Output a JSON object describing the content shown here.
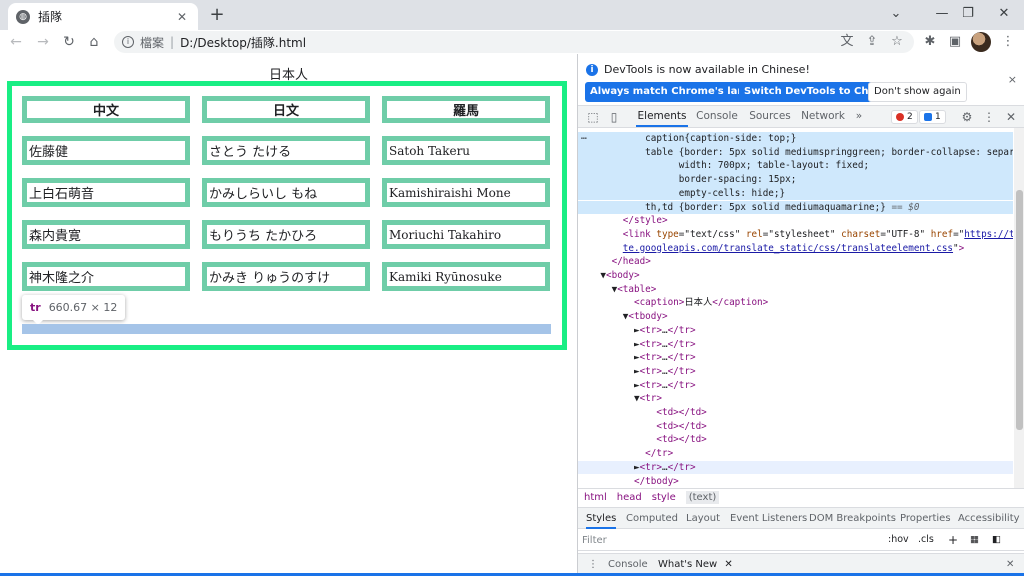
{
  "browser": {
    "tab_title": "插隊",
    "tab_close": "✕",
    "new_tab": "+",
    "window_controls": [
      "⌄",
      "—",
      "❐",
      "✕"
    ]
  },
  "toolbar": {
    "back": "←",
    "forward": "→",
    "reload": "↻",
    "home": "⌂",
    "info_glyph": "i",
    "scheme_label": "檔案",
    "separator": "|",
    "url": "D:/Desktop/插隊.html",
    "right_icons": [
      "文",
      "⇪",
      "☆"
    ],
    "extension_icons": [
      "✱",
      "▣",
      "⋮"
    ]
  },
  "page": {
    "caption": "日本人",
    "headers": [
      "中文",
      "日文",
      "羅馬"
    ],
    "rows": [
      [
        "佐藤健",
        "さとう たける",
        "Satoh Takeru"
      ],
      [
        "上白石萌音",
        "かみしらいし もね",
        "Kamishiraishi Mone"
      ],
      [
        "森内貴寛",
        "もりうち たかひろ",
        "Moriuchi Takahiro"
      ],
      [
        "神木隆之介",
        "かみき りゅうのすけ",
        "Kamiki Ryūnosuke"
      ]
    ],
    "tooltip_tag": "tr",
    "tooltip_dims": "660.67 × 12"
  },
  "devtools": {
    "info_icon": "i",
    "info_text": "DevTools is now available in Chinese!",
    "info_close": "×",
    "btn_match_language": "Always match Chrome's language",
    "btn_switch_chinese": "Switch DevTools to Chinese",
    "btn_dont_show": "Don't show again",
    "inspect_icon": "⬚",
    "device_icon": "▯",
    "tabs": [
      "Elements",
      "Console",
      "Sources",
      "Network"
    ],
    "more_tabs": "»",
    "error_count": "2",
    "message_count": "1",
    "settings_icon": "⚙",
    "menu_icon": "⋮",
    "close_icon": "✕",
    "breadcrumbs": [
      "html",
      "head",
      "style",
      "(text)"
    ],
    "sub_tabs": [
      "Styles",
      "Computed",
      "Layout",
      "Event Listeners",
      "DOM Breakpoints",
      "Properties",
      "Accessibility"
    ],
    "filter_placeholder": "Filter",
    "filter_tools": [
      ":hov",
      ".cls",
      "+"
    ],
    "drawer_menu": "⋮",
    "drawer_tabs": [
      "Console",
      "What's New"
    ],
    "drawer_tab_close": "✕",
    "drawer_close": "✕",
    "code_lines": [
      {
        "sel": true,
        "text": "            caption{caption-side: top;}"
      },
      {
        "sel": true,
        "text": "            table {border: 5px solid mediumspringgreen; border-collapse: separate;"
      },
      {
        "sel": true,
        "text": "                  width: 700px; table-layout: fixed;"
      },
      {
        "sel": true,
        "text": "                  border-spacing: 15px;"
      },
      {
        "sel": true,
        "text": "                  empty-cells: hide;}"
      },
      {
        "sel": true,
        "text": "            th,td {border: 5px solid mediumaquamarine;} == $0"
      },
      {
        "sel": false,
        "text": "        </style>"
      },
      {
        "sel": false,
        "text": "        <link type=\"text/css\" rel=\"stylesheet\" charset=\"UTF-8\" href=\"https://transla"
      },
      {
        "sel": false,
        "text": "        te.googleapis.com/translate_static/css/translateelement.css\">"
      },
      {
        "sel": false,
        "text": "      </head>"
      },
      {
        "sel": false,
        "text": "    ▼<body>"
      },
      {
        "sel": false,
        "text": "      ▼<table>"
      },
      {
        "sel": false,
        "text": "          <caption>日本人</caption>"
      },
      {
        "sel": false,
        "text": "        ▼<tbody>"
      },
      {
        "sel": false,
        "text": "          ►<tr>…</tr>"
      },
      {
        "sel": false,
        "text": "          ►<tr>…</tr>"
      },
      {
        "sel": false,
        "text": "          ►<tr>…</tr>"
      },
      {
        "sel": false,
        "text": "          ►<tr>…</tr>"
      },
      {
        "sel": false,
        "text": "          ►<tr>…</tr>"
      },
      {
        "sel": false,
        "text": "          ▼<tr>"
      },
      {
        "sel": false,
        "text": "              <td></td>"
      },
      {
        "sel": false,
        "text": "              <td></td>"
      },
      {
        "sel": false,
        "text": "              <td></td>"
      },
      {
        "sel": false,
        "text": "            </tr>"
      },
      {
        "sel": false,
        "hover": true,
        "text": "          ►<tr>…</tr>"
      },
      {
        "sel": false,
        "text": "          </tbody>"
      }
    ]
  },
  "colors": {
    "table_border": "#19ee84",
    "cell_border": "#6fcda8",
    "highlight": "#a5c4e8",
    "accent": "#1a73e8"
  }
}
